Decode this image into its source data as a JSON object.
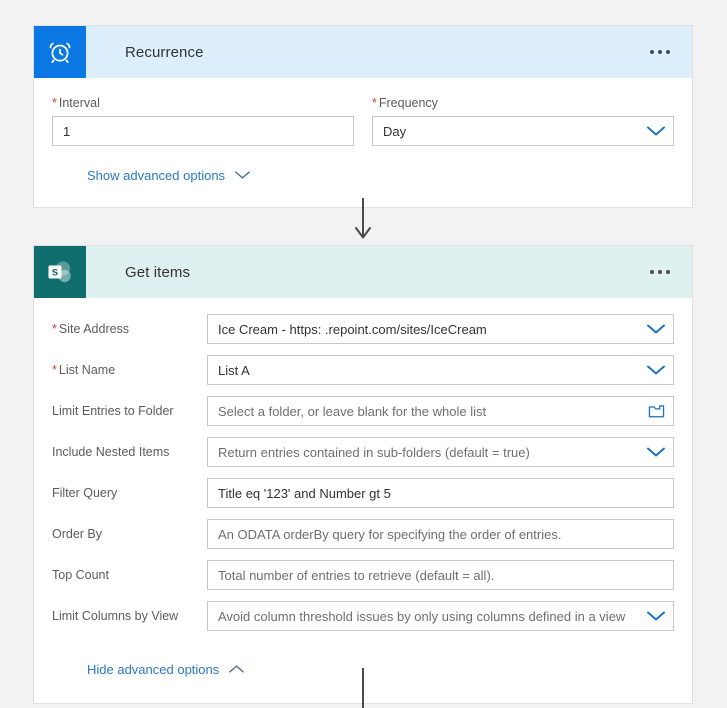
{
  "flow": {
    "steps": [
      {
        "id": "recurrence",
        "title": "Recurrence",
        "icon": "alarm-clock-icon",
        "header_color": "#ddeefc",
        "icon_color": "#0b78e3",
        "menu_label": "...",
        "fields": [
          {
            "label": "Interval",
            "required": true,
            "value": "1",
            "is_placeholder": false,
            "control": "text"
          },
          {
            "label": "Frequency",
            "required": true,
            "value": "Day",
            "is_placeholder": false,
            "control": "dropdown"
          }
        ],
        "advanced_toggle": {
          "label": "Show advanced options",
          "chevron": "chevron-down-icon",
          "expanded": false
        }
      },
      {
        "id": "get-items",
        "title": "Get items",
        "icon": "sharepoint-icon",
        "header_color": "#dff0f0",
        "icon_color": "#106e6e",
        "menu_label": "...",
        "fields": [
          {
            "label": "Site Address",
            "required": true,
            "value": "Ice Cream - https:            .repoint.com/sites/IceCream",
            "is_placeholder": false,
            "control": "dropdown"
          },
          {
            "label": "List Name",
            "required": true,
            "value": "List A",
            "is_placeholder": false,
            "control": "dropdown"
          },
          {
            "label": "Limit Entries to Folder",
            "required": false,
            "value": "Select a folder, or leave blank for the whole list",
            "is_placeholder": true,
            "control": "folder-picker"
          },
          {
            "label": "Include Nested Items",
            "required": false,
            "value": "Return entries contained in sub-folders (default = true)",
            "is_placeholder": true,
            "control": "dropdown"
          },
          {
            "label": "Filter Query",
            "required": false,
            "value": "Title eq '123' and Number gt 5",
            "is_placeholder": false,
            "control": "text"
          },
          {
            "label": "Order By",
            "required": false,
            "value": "An ODATA orderBy query for specifying the order of entries.",
            "is_placeholder": true,
            "control": "text"
          },
          {
            "label": "Top Count",
            "required": false,
            "value": "Total number of entries to retrieve (default = all).",
            "is_placeholder": true,
            "control": "text"
          },
          {
            "label": "Limit Columns by View",
            "required": false,
            "value": "Avoid column threshold issues by only using columns defined in a view",
            "is_placeholder": true,
            "control": "dropdown"
          }
        ],
        "advanced_toggle": {
          "label": "Hide advanced options",
          "chevron": "chevron-up-icon",
          "expanded": true
        }
      }
    ],
    "colors": {
      "accent_blue": "#2b78c8",
      "required_red": "#c9423b",
      "connector": "#4a4a4a",
      "page_background": "#f2f2f2"
    }
  }
}
